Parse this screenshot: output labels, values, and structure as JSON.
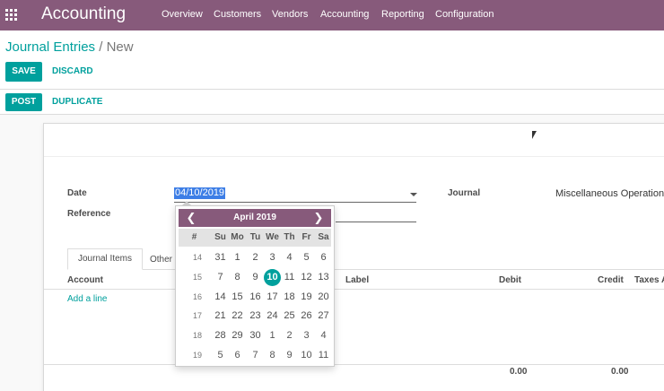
{
  "navbar": {
    "brand": "Accounting",
    "menu": [
      "Overview",
      "Customers",
      "Vendors",
      "Accounting",
      "Reporting",
      "Configuration"
    ],
    "bg_color": "#875a7b"
  },
  "breadcrumb": {
    "parent": "Journal Entries",
    "separator": "/",
    "current": "New"
  },
  "buttons": {
    "save": "SAVE",
    "discard": "DISCARD",
    "post": "POST",
    "duplicate": "DUPLICATE"
  },
  "form": {
    "date_label": "Date",
    "date_value": "04/10/2019",
    "reference_label": "Reference",
    "journal_label": "Journal",
    "journal_value": "Miscellaneous Operations ("
  },
  "tabs": {
    "active": "Journal Items",
    "other": "Other"
  },
  "table": {
    "columns": [
      "Account",
      "Label",
      "Debit",
      "Credit",
      "Taxes A"
    ],
    "add_line": "Add a line",
    "debit_total": "0.00",
    "credit_total": "0.00"
  },
  "datepicker": {
    "title": "April 2019",
    "prev_icon": "chevron-left-icon",
    "next_icon": "chevron-right-icon",
    "week_header": "#",
    "dow": [
      "Su",
      "Mo",
      "Tu",
      "We",
      "Th",
      "Fr",
      "Sa"
    ],
    "weeks": [
      {
        "num": "14",
        "days": [
          "31",
          "1",
          "2",
          "3",
          "4",
          "5",
          "6"
        ]
      },
      {
        "num": "15",
        "days": [
          "7",
          "8",
          "9",
          "10",
          "11",
          "12",
          "13"
        ]
      },
      {
        "num": "16",
        "days": [
          "14",
          "15",
          "16",
          "17",
          "18",
          "19",
          "20"
        ]
      },
      {
        "num": "17",
        "days": [
          "21",
          "22",
          "23",
          "24",
          "25",
          "26",
          "27"
        ]
      },
      {
        "num": "18",
        "days": [
          "28",
          "29",
          "30",
          "1",
          "2",
          "3",
          "4"
        ]
      },
      {
        "num": "19",
        "days": [
          "5",
          "6",
          "7",
          "8",
          "9",
          "10",
          "11"
        ]
      }
    ],
    "selected_day": "10",
    "accent_color": "#00a09d"
  }
}
